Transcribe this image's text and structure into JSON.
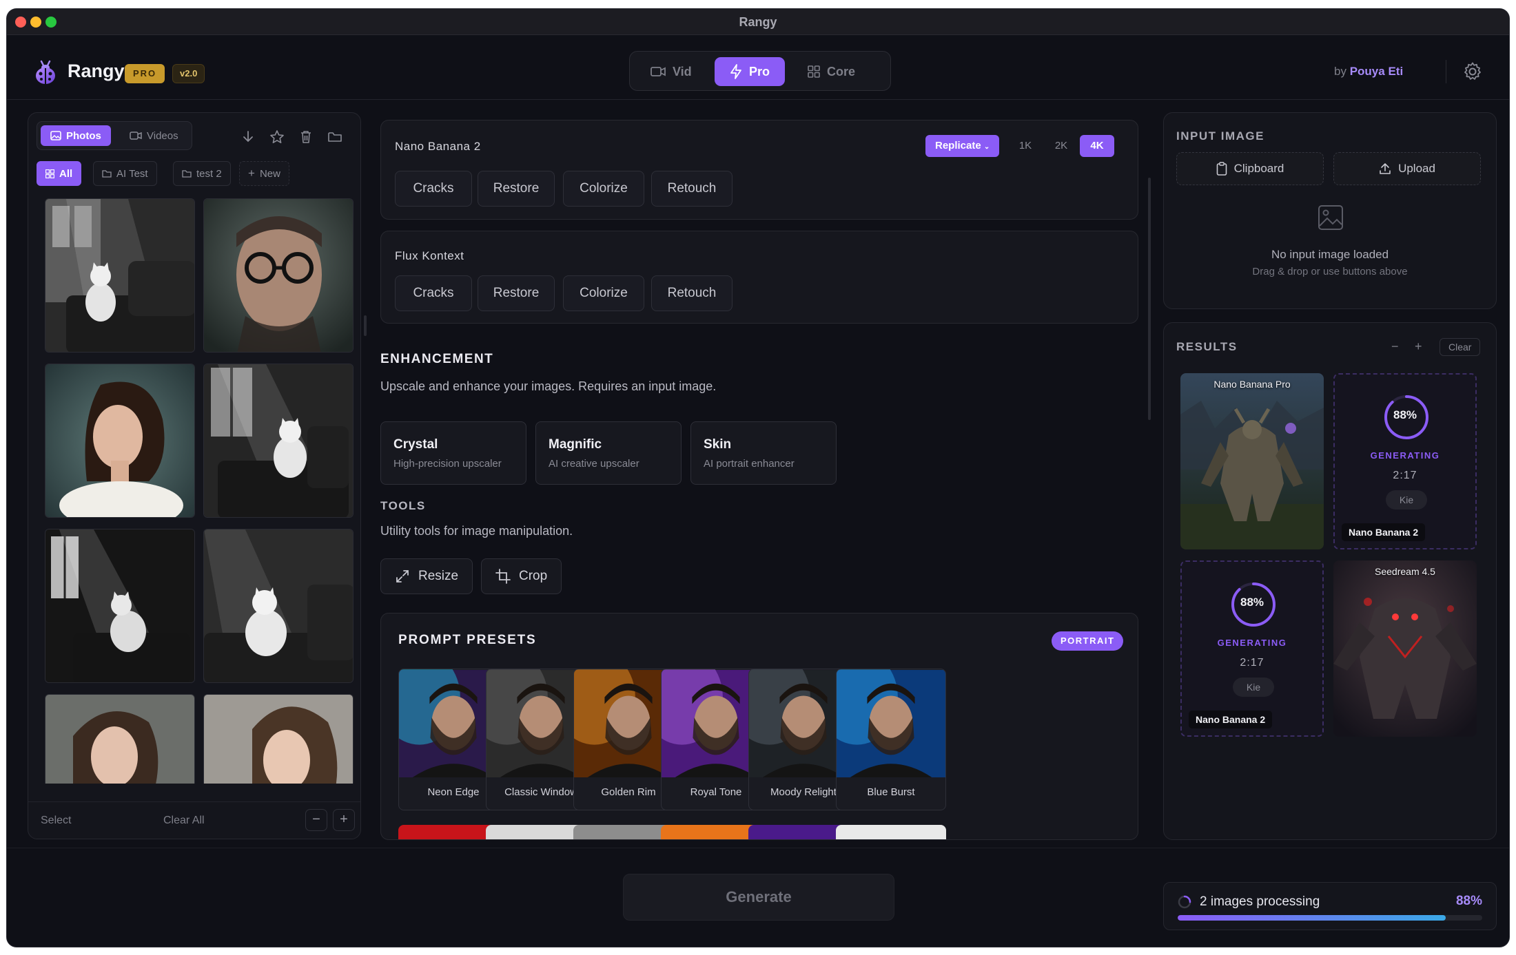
{
  "window": {
    "title": "Rangy"
  },
  "header": {
    "brand": "Rangy",
    "badge": "PRO",
    "version": "v2.0",
    "modes": [
      {
        "label": "Vid",
        "icon": "video-icon",
        "active": false
      },
      {
        "label": "Pro",
        "icon": "bolt-icon",
        "active": true
      },
      {
        "label": "Core",
        "icon": "grid-icon",
        "active": false
      }
    ],
    "by": "by",
    "author": "Pouya Eti"
  },
  "library": {
    "tabs": [
      {
        "label": "Photos",
        "icon": "image-icon",
        "active": true
      },
      {
        "label": "Videos",
        "icon": "video-icon",
        "active": false
      }
    ],
    "toolbar_icons": [
      "download-icon",
      "star-icon",
      "trash-icon",
      "folder-icon"
    ],
    "folders": [
      {
        "label": "All",
        "icon": "grid-icon",
        "active": true
      },
      {
        "label": "AI Test",
        "icon": "folder-icon",
        "active": false
      },
      {
        "label": "test 2",
        "icon": "folder-icon",
        "active": false
      },
      {
        "label": "New",
        "icon": "plus-icon",
        "active": false
      }
    ],
    "thumbnails": [
      "cat-armchair",
      "man-glasses",
      "woman-bob",
      "cat-window",
      "cat-chair-dark",
      "cat-chair-light",
      "woman-portrait",
      "woman-portrait-2"
    ],
    "footer": {
      "select": "Select",
      "clear_all": "Clear All",
      "minus": "−",
      "plus": "+"
    }
  },
  "models": [
    {
      "name": "Nano Banana 2",
      "provider": "Replicate",
      "resolutions": [
        "1K",
        "2K",
        "4K"
      ],
      "active_resolution": "4K",
      "actions": [
        "Cracks",
        "Restore",
        "Colorize",
        "Retouch"
      ]
    },
    {
      "name": "Flux Kontext",
      "actions": [
        "Cracks",
        "Restore",
        "Colorize",
        "Retouch"
      ]
    }
  ],
  "enhancement": {
    "title": "ENHANCEMENT",
    "description": "Upscale and enhance your images. Requires an input image.",
    "items": [
      {
        "name": "Crystal",
        "desc": "High-precision upscaler"
      },
      {
        "name": "Magnific",
        "desc": "AI creative upscaler"
      },
      {
        "name": "Skin",
        "desc": "AI portrait enhancer"
      }
    ]
  },
  "tools": {
    "title": "TOOLS",
    "description": "Utility tools for image manipulation.",
    "items": [
      {
        "label": "Resize",
        "icon": "expand-icon"
      },
      {
        "label": "Crop",
        "icon": "crop-icon"
      }
    ]
  },
  "presets": {
    "title": "PROMPT PRESETS",
    "category": "PORTRAIT",
    "items": [
      {
        "label": "Neon Edge",
        "bg": "#2a1a4a",
        "accent": "#1ec8e8"
      },
      {
        "label": "Classic Window",
        "bg": "#2b2b2b",
        "accent": "#6b6b6b"
      },
      {
        "label": "Golden Rim",
        "bg": "#5a2a06",
        "accent": "#f39a2a"
      },
      {
        "label": "Royal Tone",
        "bg": "#4a1a7a",
        "accent": "#b066e6"
      },
      {
        "label": "Moody Relight",
        "bg": "#1e2226",
        "accent": "#5b6670"
      },
      {
        "label": "Blue Burst",
        "bg": "#0b3a7a",
        "accent": "#2aa8f0"
      }
    ],
    "next_row_colors": [
      "#c8141a",
      "#d9d9d9",
      "#8d8d8d",
      "#e8741a",
      "#4a1a8a",
      "#e9e9e9"
    ]
  },
  "input_image": {
    "title": "INPUT IMAGE",
    "clipboard": "Clipboard",
    "upload": "Upload",
    "empty_title": "No input image loaded",
    "empty_hint": "Drag & drop or use buttons above"
  },
  "results": {
    "title": "RESULTS",
    "minus": "−",
    "plus": "+",
    "clear": "Clear",
    "cards": [
      {
        "type": "image",
        "model": "Nano Banana Pro",
        "scene": "stone-golem"
      },
      {
        "type": "generating",
        "progress": 88,
        "progress_label": "88%",
        "status": "GENERATING",
        "time": "2:17",
        "provider": "Kie",
        "model": "Nano Banana 2"
      },
      {
        "type": "generating",
        "progress": 88,
        "progress_label": "88%",
        "status": "GENERATING",
        "time": "2:17",
        "provider": "Kie",
        "model": "Nano Banana 2"
      },
      {
        "type": "image",
        "model": "Seedream 4.5",
        "scene": "red-demon"
      }
    ]
  },
  "footer": {
    "generate": "Generate",
    "processing_text": "2 images processing",
    "processing_pct_label": "88%",
    "processing_progress": 0.88
  },
  "colors": {
    "accent": "#8b5cf6",
    "accent_light": "#a78bfa",
    "gold": "#c89a2b",
    "bg": "#0f1017",
    "panel": "#14151c"
  }
}
